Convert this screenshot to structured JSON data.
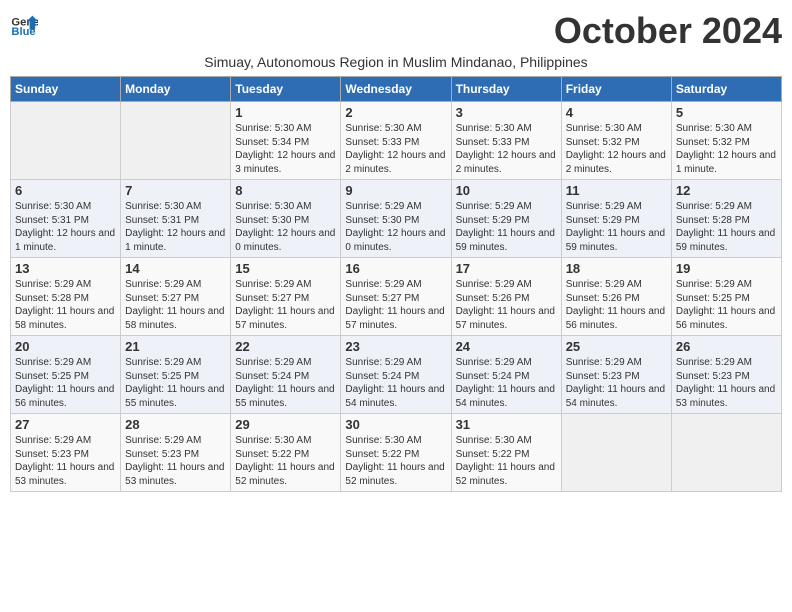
{
  "header": {
    "logo_line1": "General",
    "logo_line2": "Blue",
    "month_title": "October 2024",
    "location": "Simuay, Autonomous Region in Muslim Mindanao, Philippines"
  },
  "weekdays": [
    "Sunday",
    "Monday",
    "Tuesday",
    "Wednesday",
    "Thursday",
    "Friday",
    "Saturday"
  ],
  "weeks": [
    [
      {
        "day": "",
        "sunrise": "",
        "sunset": "",
        "daylight": ""
      },
      {
        "day": "",
        "sunrise": "",
        "sunset": "",
        "daylight": ""
      },
      {
        "day": "1",
        "sunrise": "Sunrise: 5:30 AM",
        "sunset": "Sunset: 5:34 PM",
        "daylight": "Daylight: 12 hours and 3 minutes."
      },
      {
        "day": "2",
        "sunrise": "Sunrise: 5:30 AM",
        "sunset": "Sunset: 5:33 PM",
        "daylight": "Daylight: 12 hours and 2 minutes."
      },
      {
        "day": "3",
        "sunrise": "Sunrise: 5:30 AM",
        "sunset": "Sunset: 5:33 PM",
        "daylight": "Daylight: 12 hours and 2 minutes."
      },
      {
        "day": "4",
        "sunrise": "Sunrise: 5:30 AM",
        "sunset": "Sunset: 5:32 PM",
        "daylight": "Daylight: 12 hours and 2 minutes."
      },
      {
        "day": "5",
        "sunrise": "Sunrise: 5:30 AM",
        "sunset": "Sunset: 5:32 PM",
        "daylight": "Daylight: 12 hours and 1 minute."
      }
    ],
    [
      {
        "day": "6",
        "sunrise": "Sunrise: 5:30 AM",
        "sunset": "Sunset: 5:31 PM",
        "daylight": "Daylight: 12 hours and 1 minute."
      },
      {
        "day": "7",
        "sunrise": "Sunrise: 5:30 AM",
        "sunset": "Sunset: 5:31 PM",
        "daylight": "Daylight: 12 hours and 1 minute."
      },
      {
        "day": "8",
        "sunrise": "Sunrise: 5:30 AM",
        "sunset": "Sunset: 5:30 PM",
        "daylight": "Daylight: 12 hours and 0 minutes."
      },
      {
        "day": "9",
        "sunrise": "Sunrise: 5:29 AM",
        "sunset": "Sunset: 5:30 PM",
        "daylight": "Daylight: 12 hours and 0 minutes."
      },
      {
        "day": "10",
        "sunrise": "Sunrise: 5:29 AM",
        "sunset": "Sunset: 5:29 PM",
        "daylight": "Daylight: 11 hours and 59 minutes."
      },
      {
        "day": "11",
        "sunrise": "Sunrise: 5:29 AM",
        "sunset": "Sunset: 5:29 PM",
        "daylight": "Daylight: 11 hours and 59 minutes."
      },
      {
        "day": "12",
        "sunrise": "Sunrise: 5:29 AM",
        "sunset": "Sunset: 5:28 PM",
        "daylight": "Daylight: 11 hours and 59 minutes."
      }
    ],
    [
      {
        "day": "13",
        "sunrise": "Sunrise: 5:29 AM",
        "sunset": "Sunset: 5:28 PM",
        "daylight": "Daylight: 11 hours and 58 minutes."
      },
      {
        "day": "14",
        "sunrise": "Sunrise: 5:29 AM",
        "sunset": "Sunset: 5:27 PM",
        "daylight": "Daylight: 11 hours and 58 minutes."
      },
      {
        "day": "15",
        "sunrise": "Sunrise: 5:29 AM",
        "sunset": "Sunset: 5:27 PM",
        "daylight": "Daylight: 11 hours and 57 minutes."
      },
      {
        "day": "16",
        "sunrise": "Sunrise: 5:29 AM",
        "sunset": "Sunset: 5:27 PM",
        "daylight": "Daylight: 11 hours and 57 minutes."
      },
      {
        "day": "17",
        "sunrise": "Sunrise: 5:29 AM",
        "sunset": "Sunset: 5:26 PM",
        "daylight": "Daylight: 11 hours and 57 minutes."
      },
      {
        "day": "18",
        "sunrise": "Sunrise: 5:29 AM",
        "sunset": "Sunset: 5:26 PM",
        "daylight": "Daylight: 11 hours and 56 minutes."
      },
      {
        "day": "19",
        "sunrise": "Sunrise: 5:29 AM",
        "sunset": "Sunset: 5:25 PM",
        "daylight": "Daylight: 11 hours and 56 minutes."
      }
    ],
    [
      {
        "day": "20",
        "sunrise": "Sunrise: 5:29 AM",
        "sunset": "Sunset: 5:25 PM",
        "daylight": "Daylight: 11 hours and 56 minutes."
      },
      {
        "day": "21",
        "sunrise": "Sunrise: 5:29 AM",
        "sunset": "Sunset: 5:25 PM",
        "daylight": "Daylight: 11 hours and 55 minutes."
      },
      {
        "day": "22",
        "sunrise": "Sunrise: 5:29 AM",
        "sunset": "Sunset: 5:24 PM",
        "daylight": "Daylight: 11 hours and 55 minutes."
      },
      {
        "day": "23",
        "sunrise": "Sunrise: 5:29 AM",
        "sunset": "Sunset: 5:24 PM",
        "daylight": "Daylight: 11 hours and 54 minutes."
      },
      {
        "day": "24",
        "sunrise": "Sunrise: 5:29 AM",
        "sunset": "Sunset: 5:24 PM",
        "daylight": "Daylight: 11 hours and 54 minutes."
      },
      {
        "day": "25",
        "sunrise": "Sunrise: 5:29 AM",
        "sunset": "Sunset: 5:23 PM",
        "daylight": "Daylight: 11 hours and 54 minutes."
      },
      {
        "day": "26",
        "sunrise": "Sunrise: 5:29 AM",
        "sunset": "Sunset: 5:23 PM",
        "daylight": "Daylight: 11 hours and 53 minutes."
      }
    ],
    [
      {
        "day": "27",
        "sunrise": "Sunrise: 5:29 AM",
        "sunset": "Sunset: 5:23 PM",
        "daylight": "Daylight: 11 hours and 53 minutes."
      },
      {
        "day": "28",
        "sunrise": "Sunrise: 5:29 AM",
        "sunset": "Sunset: 5:23 PM",
        "daylight": "Daylight: 11 hours and 53 minutes."
      },
      {
        "day": "29",
        "sunrise": "Sunrise: 5:30 AM",
        "sunset": "Sunset: 5:22 PM",
        "daylight": "Daylight: 11 hours and 52 minutes."
      },
      {
        "day": "30",
        "sunrise": "Sunrise: 5:30 AM",
        "sunset": "Sunset: 5:22 PM",
        "daylight": "Daylight: 11 hours and 52 minutes."
      },
      {
        "day": "31",
        "sunrise": "Sunrise: 5:30 AM",
        "sunset": "Sunset: 5:22 PM",
        "daylight": "Daylight: 11 hours and 52 minutes."
      },
      {
        "day": "",
        "sunrise": "",
        "sunset": "",
        "daylight": ""
      },
      {
        "day": "",
        "sunrise": "",
        "sunset": "",
        "daylight": ""
      }
    ]
  ]
}
